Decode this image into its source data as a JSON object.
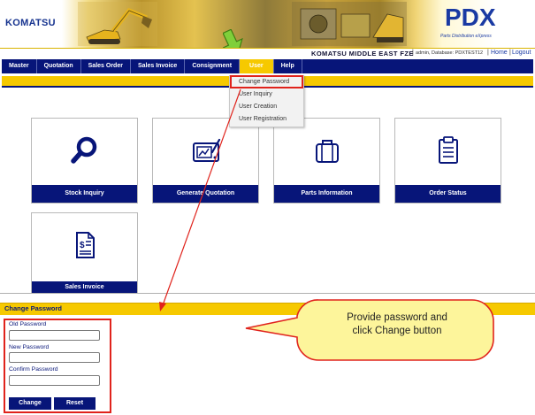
{
  "header": {
    "brand_logo": "KOMATSU",
    "app_logo": "PDX",
    "app_logo_sub": "Parts Distribution eXpress",
    "company_name": "KOMATSU MIDDLE EAST FZE",
    "user_info": "admin, Database: PDXTEST12",
    "separator": "|",
    "home_link": "Home",
    "logout_link": "Logout"
  },
  "nav": {
    "items": [
      {
        "label": "Master"
      },
      {
        "label": "Quotation"
      },
      {
        "label": "Sales Order"
      },
      {
        "label": "Sales Invoice"
      },
      {
        "label": "Consignment"
      },
      {
        "label": "User"
      },
      {
        "label": "Help"
      }
    ],
    "active": "User"
  },
  "user_menu": {
    "items": [
      {
        "label": "Change Password"
      },
      {
        "label": "User Inquiry"
      },
      {
        "label": "User Creation"
      },
      {
        "label": "User Registration"
      }
    ]
  },
  "tiles": [
    {
      "label": "Stock Inquiry",
      "icon": "magnifier-icon"
    },
    {
      "label": "Generate Quotation",
      "icon": "drawing-tablet-icon"
    },
    {
      "label": "Parts Information",
      "icon": "toolbox-icon"
    },
    {
      "label": "Order Status",
      "icon": "clipboard-icon"
    },
    {
      "label": "Sales Invoice",
      "icon": "invoice-icon"
    }
  ],
  "change_password": {
    "title": "Change Password",
    "old_label": "Old Password",
    "new_label": "New Password",
    "confirm_label": "Confirm Password",
    "old_value": "",
    "new_value": "",
    "confirm_value": "",
    "change_button": "Change",
    "reset_button": "Reset"
  },
  "callout": {
    "line1": "Provide password and",
    "line2": "click Change button"
  },
  "colors": {
    "navy": "#071579",
    "yellow": "#f6c900",
    "highlight_red": "#e0231c",
    "callout_fill": "#fdf59b"
  }
}
